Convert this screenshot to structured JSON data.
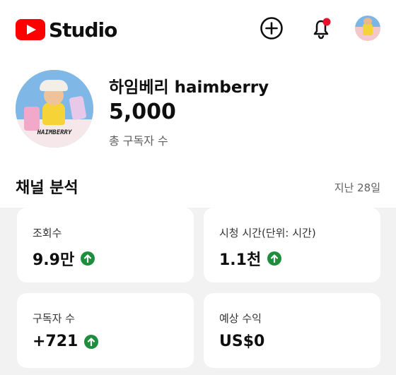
{
  "app": {
    "brand_text": "Studio",
    "accent_color": "#ff0000",
    "icons": [
      "create-icon",
      "notification-bell-icon",
      "account-avatar"
    ]
  },
  "channel": {
    "avatar_text": "HAIMBERRY",
    "name": "하임베리 haimberry",
    "subscribers": "5,000",
    "subscribers_label": "총 구독자 수"
  },
  "analytics": {
    "title": "채널 분석",
    "period": "지난 28일",
    "trend_color": "#1e8e3e",
    "metrics": [
      {
        "label": "조회수",
        "value": "9.9만",
        "trend": "up"
      },
      {
        "label": "시청 시간(단위: 시간)",
        "value": "1.1천",
        "trend": "up"
      },
      {
        "label": "구독자 수",
        "value": "+721",
        "trend": "up"
      },
      {
        "label": "예상 수익",
        "value": "US$0",
        "trend": "none"
      }
    ]
  }
}
